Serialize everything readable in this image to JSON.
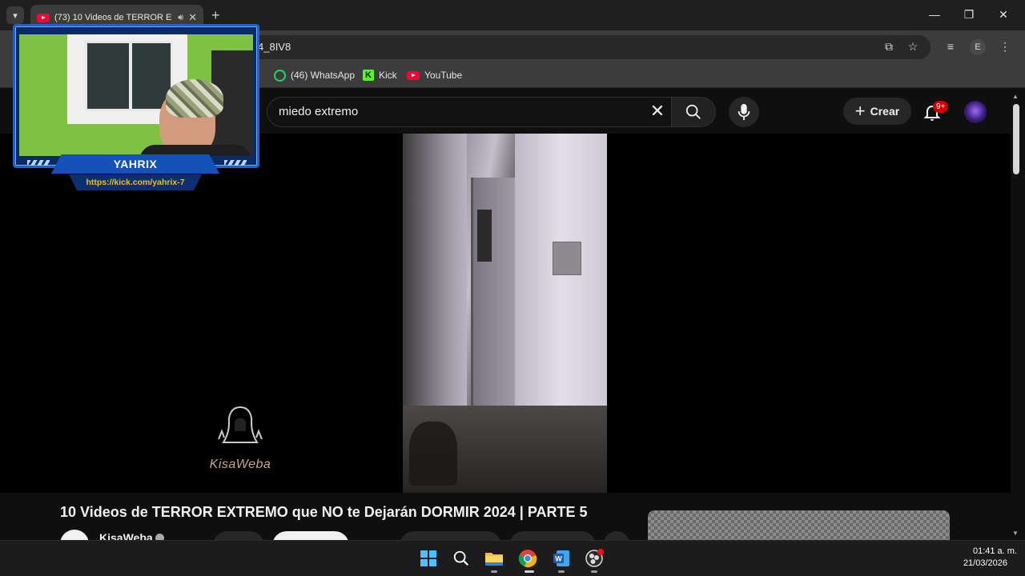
{
  "browser": {
    "tab": {
      "title": "(73) 10 Videos de TERROR E"
    },
    "url": "4_8IV8",
    "bookmarks": [
      {
        "label": "(46) WhatsApp",
        "icon": "whatsapp-icon"
      },
      {
        "label": "Kick",
        "icon": "kick-icon"
      },
      {
        "label": "YouTube",
        "icon": "youtube-icon"
      }
    ],
    "profile_initial": "E"
  },
  "youtube": {
    "search": {
      "value": "miedo extremo"
    },
    "create_label": "Crear",
    "notifications_badge": "9+",
    "video": {
      "title": "10 Videos de TERROR EXTREMO que NO te Dejarán DORMIR 2024 | PARTE 5",
      "channel": "KisaWeba",
      "watermark": "KisaWeba"
    }
  },
  "stream_overlay": {
    "streamer_name": "YAHRIX",
    "url": "https://kick.com/yahrix-7",
    "colors": {
      "frame": "#1d63c9",
      "url_text": "#f5b72c"
    }
  },
  "taskbar": {
    "apps": [
      "windows-start-icon",
      "search-icon",
      "file-explorer-icon",
      "chrome-icon",
      "word-icon",
      "obs-icon"
    ],
    "time": "01:41 a. m.",
    "date": "21/03/2026"
  },
  "colors": {
    "youtube_red": "#ff0033",
    "badge_red": "#cc0000",
    "kick_green": "#53fc18"
  }
}
